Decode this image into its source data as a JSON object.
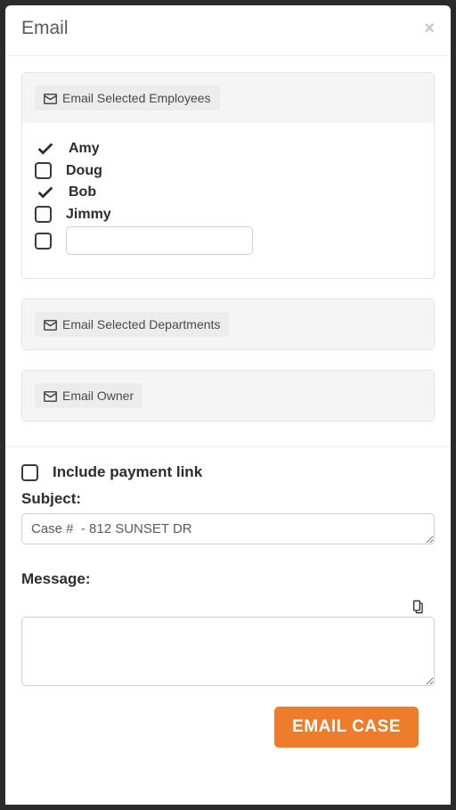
{
  "modal": {
    "title": "Email",
    "close": "×"
  },
  "sections": {
    "employees": {
      "chip": "Email Selected Employees",
      "items": [
        {
          "name": "Amy",
          "checked": true
        },
        {
          "name": "Doug",
          "checked": false
        },
        {
          "name": "Bob",
          "checked": true
        },
        {
          "name": "Jimmy",
          "checked": false
        }
      ],
      "extra_input_value": ""
    },
    "departments": {
      "chip": "Email Selected Departments"
    },
    "owner": {
      "chip": "Email Owner"
    }
  },
  "include_payment": {
    "label": "Include payment link",
    "checked": false
  },
  "subject": {
    "label": "Subject:",
    "value": "Case #  - 812 SUNSET DR"
  },
  "message": {
    "label": "Message:",
    "value": ""
  },
  "footer": {
    "submit": "EMAIL CASE"
  }
}
